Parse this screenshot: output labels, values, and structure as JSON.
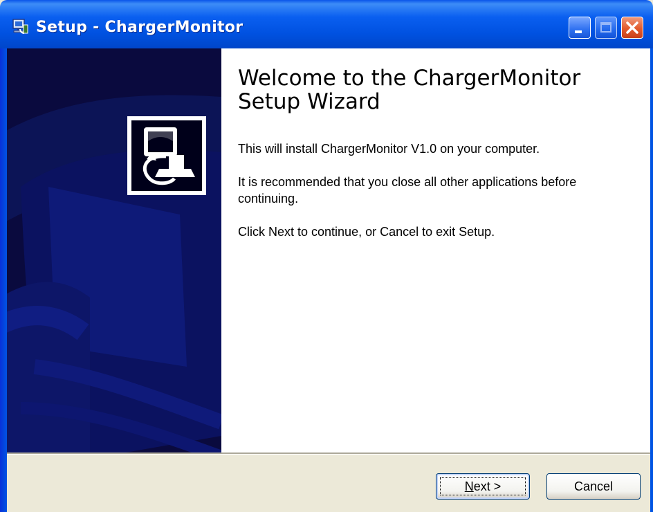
{
  "window": {
    "title": "Setup - ChargerMonitor",
    "title_bar_color": "#0a5ff0",
    "controls": {
      "minimize_icon": "minimize-icon",
      "maximize_icon": "maximize-icon",
      "close_icon": "close-icon"
    }
  },
  "banner": {
    "background_color": "#0a0a3e",
    "logo_icon": "installer-computer-icon"
  },
  "content": {
    "heading": "Welcome to the ChargerMonitor Setup Wizard",
    "paragraphs": [
      "This will install ChargerMonitor V1.0 on your computer.",
      "It is recommended that you close all other applications before continuing.",
      "Click Next to continue, or Cancel to exit Setup."
    ]
  },
  "buttons": {
    "next_mnemonic": "N",
    "next_rest": "ext >",
    "cancel": "Cancel"
  }
}
